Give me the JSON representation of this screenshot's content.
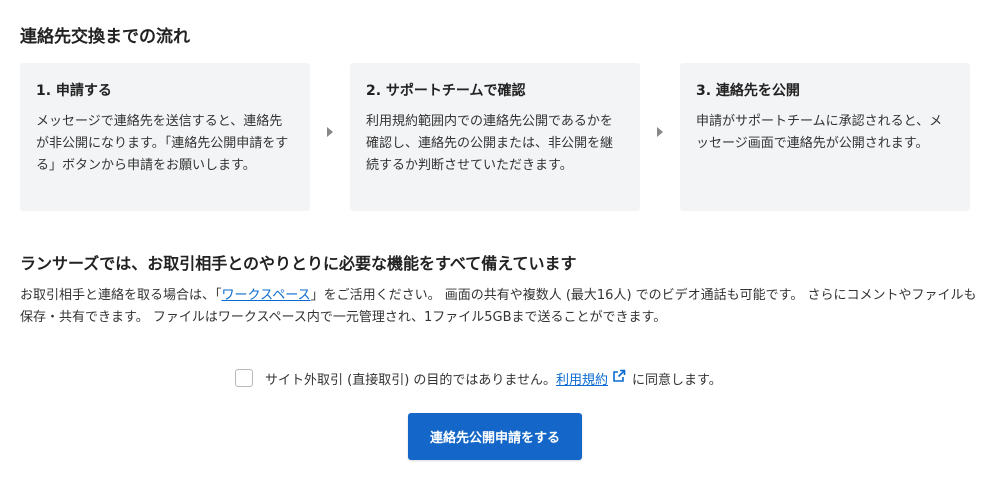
{
  "section": {
    "title": "連絡先交換までの流れ"
  },
  "steps": [
    {
      "title": "1. 申請する",
      "description": "メッセージで連絡先を送信すると、連絡先が非公開になります。「連絡先公開申請をする」ボタンから申請をお願いします。"
    },
    {
      "title": "2. サポートチームで確認",
      "description": "利用規約範囲内での連絡先公開であるかを確認し、連絡先の公開または、非公開を継続するか判断させていただきます。"
    },
    {
      "title": "3. 連絡先を公開",
      "description": "申請がサポートチームに承認されると、メッセージ画面で連絡先が公開されます。"
    }
  ],
  "feature": {
    "title": "ランサーズでは、お取引相手とのやりとりに必要な機能をすべて備えています",
    "desc_before_link": "お取引相手と連絡を取る場合は、「",
    "link_text": "ワークスペース",
    "desc_after_link": "」をご活用ください。 画面の共有や複数人 (最大16人) でのビデオ通話も可能です。 さらにコメントやファイルも保存・共有できます。 ファイルはワークスペース内で一元管理され、1ファイル5GBまで送ることができます。"
  },
  "agreement": {
    "checked": false,
    "text_before_link": "サイト外取引 (直接取引) の目的ではありません。",
    "link_text": "利用規約",
    "text_after_link": "に同意します。",
    "icon": "external-link-icon"
  },
  "submit": {
    "label": "連絡先公開申請をする"
  },
  "colors": {
    "accent": "#1467c8",
    "link": "#0b6bd1",
    "step_background": "#f3f4f6"
  }
}
